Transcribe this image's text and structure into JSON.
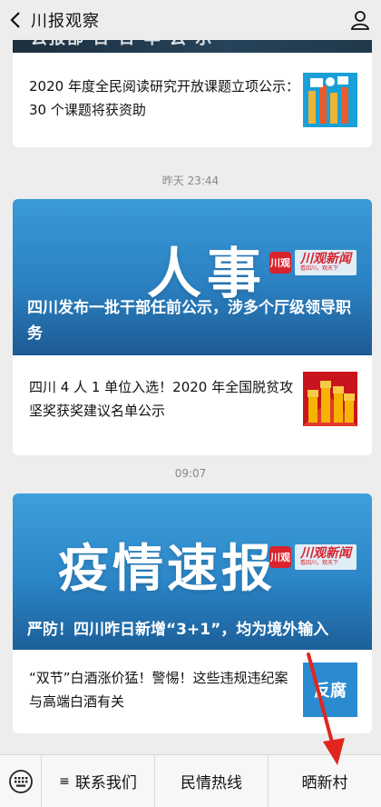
{
  "header": {
    "title": "川报观察"
  },
  "card1": {
    "banner_ghost_text": "云报部 日 日 卒 云 示",
    "article": "2020 年度全民阅读研究开放课题立项公示：30 个课题将获资助"
  },
  "time1": "昨天 23:44",
  "card2": {
    "banner_big": "人事",
    "logo_mark": "川观",
    "logo_name": "川观新闻",
    "logo_slogan": "看四川，观天下",
    "headline": "四川发布一批干部任前公示，涉多个厅级领导职务",
    "article": "四川 4 人 1 单位入选！2020 年全国脱贫攻坚奖获奖建议名单公示"
  },
  "time2": "09:07",
  "card3": {
    "banner_big": "疫情速报",
    "logo_mark": "川观",
    "logo_name": "川观新闻",
    "logo_slogan": "看四川，观天下",
    "headline": "严防！四川昨日新增“3+1”，均为境外输入",
    "article": "“双节”白酒涨价猛！警惕！这些违规违纪案与高端白酒有关",
    "thumb_label": "反腐"
  },
  "bottom_menu": {
    "items": [
      "联系我们",
      "民情热线",
      "晒新村"
    ]
  },
  "colors": {
    "accent_blue": "#2b81c2",
    "brand_red": "#d9232d",
    "arrow_red": "#e0261f"
  }
}
